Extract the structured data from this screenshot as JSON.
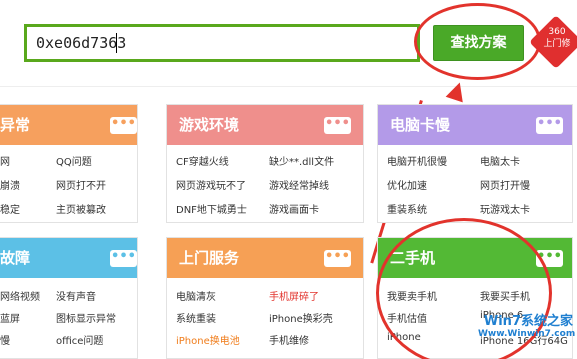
{
  "search": {
    "value": "0xe06d7363",
    "button_label": "查找方案"
  },
  "badge": {
    "top": "360",
    "bottom": "上门修"
  },
  "cards": {
    "c1": {
      "title": "异常",
      "more": "•••",
      "links": [
        "网",
        "QQ问题",
        "崩溃",
        "网页打不开",
        "稳定",
        "主页被篡改"
      ]
    },
    "c2": {
      "title": "游戏环境",
      "more": "•••",
      "links": [
        "CF穿越火线",
        "缺少**.dll文件",
        "网页游戏玩不了",
        "游戏经常掉线",
        "DNF地下城勇士",
        "游戏画面卡"
      ]
    },
    "c3": {
      "title": "电脑卡慢",
      "more": "•••",
      "links": [
        "电脑开机很慢",
        "电脑太卡",
        "优化加速",
        "网页打开慢",
        "重装系统",
        "玩游戏太卡"
      ]
    },
    "c4": {
      "title": "故障",
      "more": "•••",
      "links": [
        "网络视频",
        "没有声音",
        "蓝屏",
        "图标显示异常",
        "慢",
        "office问题"
      ]
    },
    "c5": {
      "title": "上门服务",
      "more": "•••",
      "links": [
        "电脑清灰",
        "手机屏碎了",
        "系统重装",
        "iPhone换彩壳",
        "iPhone换电池",
        "手机维修"
      ]
    },
    "c6": {
      "title": "二手机",
      "more": "•••",
      "links": [
        "我要卖手机",
        "我要买手机",
        "手机估值",
        "iPhone 6",
        "iPhone",
        "iPhone 16G行64G"
      ]
    }
  },
  "watermark": {
    "title": "Win7系统之家",
    "sub": "Www.Winwin7.com"
  },
  "colors": {
    "orange": "#f6a05e",
    "pink": "#ef8f8c",
    "purple": "#b39ae8",
    "green": "#53b935",
    "blue": "#5cc0e6",
    "orange2": "#f6a055"
  }
}
